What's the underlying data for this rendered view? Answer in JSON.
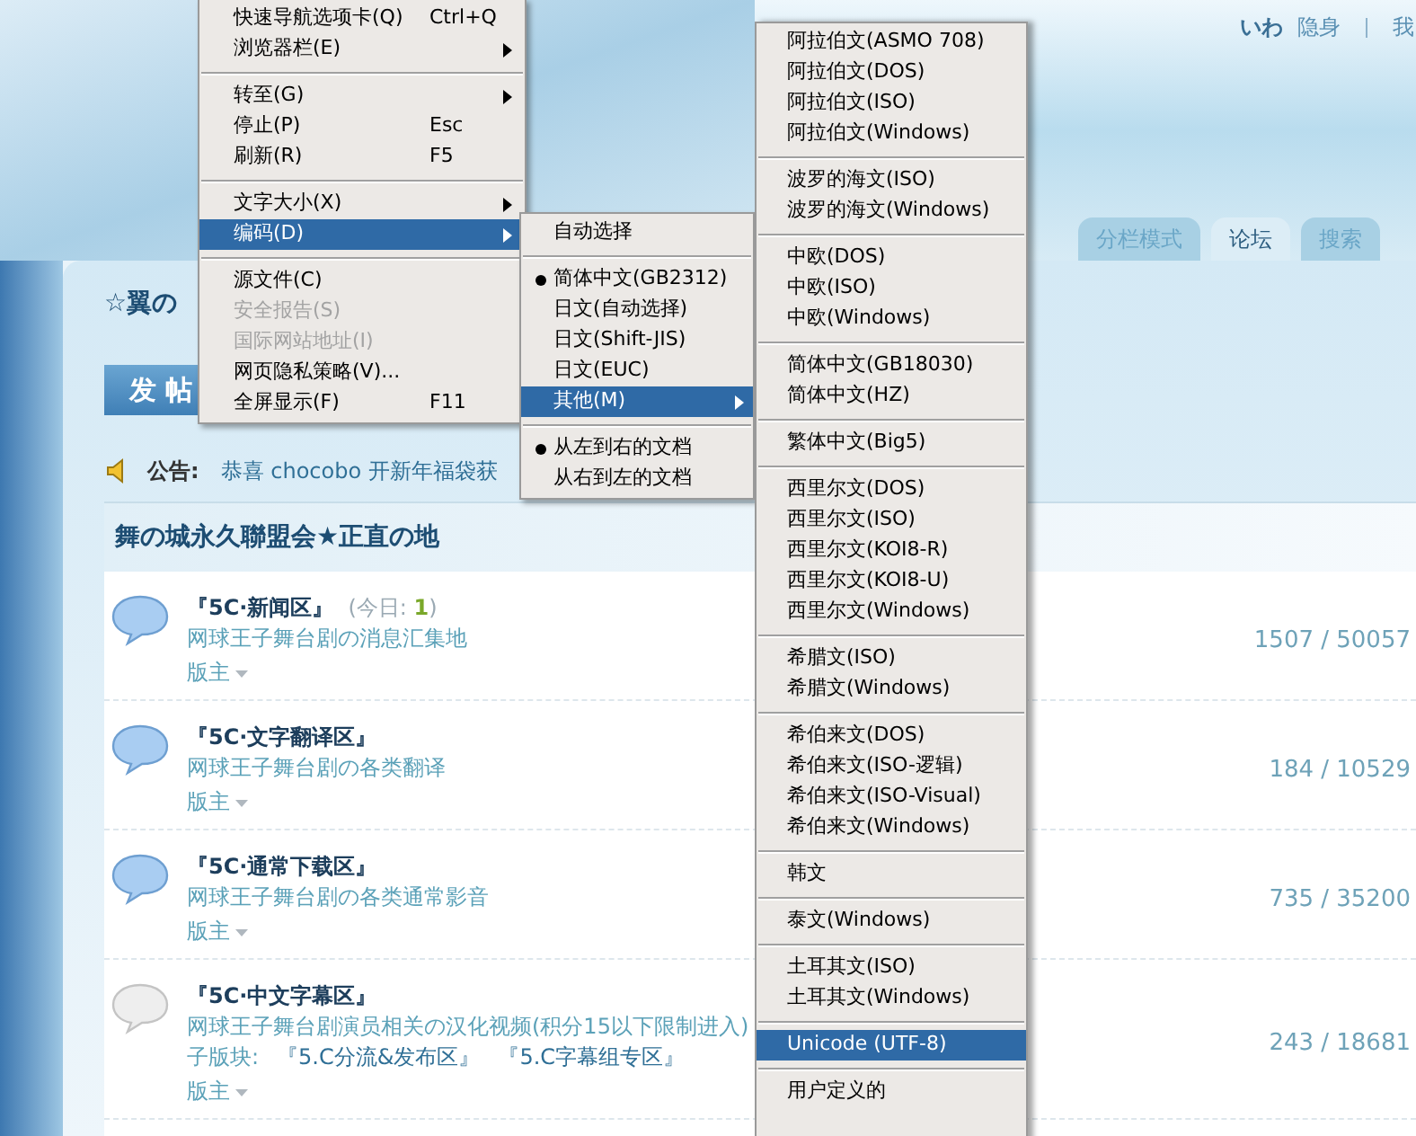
{
  "header": {
    "user": "いわ",
    "links": [
      "隐身",
      "我"
    ],
    "tabs": [
      {
        "label": "分栏模式",
        "selected": false
      },
      {
        "label": "论坛",
        "selected": true
      },
      {
        "label": "搜索",
        "selected": false
      }
    ]
  },
  "section_title": "☆翼の",
  "post_button": "发 帖",
  "notice": {
    "label": "公告:",
    "text": "恭喜 chocobo 开新年福袋获"
  },
  "category": {
    "title": "舞の城永久聯盟会★正直の地",
    "forums": [
      {
        "title": "『5C·新闻区』",
        "today": "(今日: **1**)",
        "description": "网球王子舞台剧の消息汇集地",
        "moderator": "版主",
        "stats": "1507 / 50057",
        "has_new": true
      },
      {
        "title": "『5C·文字翻译区』",
        "description": "网球王子舞台剧の各类翻译",
        "moderator": "版主",
        "stats": "184 / 10529",
        "has_new": true
      },
      {
        "title": "『5C·通常下载区』",
        "description": "网球王子舞台剧の各类通常影音",
        "moderator": "版主",
        "stats": "735 / 35200",
        "has_new": true
      },
      {
        "title": "『5C·中文字幕区』",
        "description": "网球王子舞台剧演员相关の汉化视频(积分15以下限制进入)",
        "subforums_label": "子版块:",
        "subforums": [
          "『5.C分流&发布区』",
          "『5.C字幕组专区』"
        ],
        "moderator": "版主",
        "stats": "243 / 18681",
        "has_new": false
      }
    ]
  },
  "menu": {
    "groups": [
      [
        {
          "label": "快速导航选项卡(Q)",
          "shortcut": "Ctrl+Q",
          "has_submenu": false,
          "disabled": false,
          "selected": false
        },
        {
          "label": "浏览器栏(E)",
          "has_submenu": true,
          "disabled": false,
          "selected": false
        }
      ],
      [
        {
          "label": "转至(G)",
          "has_submenu": true,
          "disabled": false,
          "selected": false
        },
        {
          "label": "停止(P)",
          "shortcut": "Esc",
          "has_submenu": false,
          "disabled": false,
          "selected": false
        },
        {
          "label": "刷新(R)",
          "shortcut": "F5",
          "has_submenu": false,
          "disabled": false,
          "selected": false
        }
      ],
      [
        {
          "label": "文字大小(X)",
          "has_submenu": true,
          "disabled": false,
          "selected": false
        },
        {
          "label": "编码(D)",
          "has_submenu": true,
          "disabled": false,
          "selected": true
        }
      ],
      [
        {
          "label": "源文件(C)",
          "has_submenu": false,
          "disabled": false,
          "selected": false
        },
        {
          "label": "安全报告(S)",
          "has_submenu": false,
          "disabled": true,
          "selected": false
        },
        {
          "label": "国际网站地址(I)",
          "has_submenu": false,
          "disabled": true,
          "selected": false
        },
        {
          "label": "网页隐私策略(V)...",
          "has_submenu": false,
          "disabled": false,
          "selected": false
        },
        {
          "label": "全屏显示(F)",
          "shortcut": "F11",
          "has_submenu": false,
          "disabled": false,
          "selected": false
        }
      ]
    ]
  },
  "encoding_menu": {
    "groups": [
      [
        {
          "label": "自动选择",
          "checked": false,
          "has_submenu": false,
          "selected": false
        }
      ],
      [
        {
          "label": "简体中文(GB2312)",
          "checked": true,
          "has_submenu": false,
          "selected": false
        },
        {
          "label": "日文(自动选择)",
          "checked": false,
          "has_submenu": false,
          "selected": false
        },
        {
          "label": "日文(Shift-JIS)",
          "checked": false,
          "has_submenu": false,
          "selected": false
        },
        {
          "label": "日文(EUC)",
          "checked": false,
          "has_submenu": false,
          "selected": false
        },
        {
          "label": "其他(M)",
          "checked": false,
          "has_submenu": true,
          "selected": true
        }
      ],
      [
        {
          "label": "从左到右的文档",
          "checked": true,
          "has_submenu": false,
          "selected": false
        },
        {
          "label": "从右到左的文档",
          "checked": false,
          "has_submenu": false,
          "selected": false
        }
      ]
    ]
  },
  "other_menu": {
    "groups": [
      [
        {
          "label": "阿拉伯文(ASMO 708)",
          "selected": false
        },
        {
          "label": "阿拉伯文(DOS)",
          "selected": false
        },
        {
          "label": "阿拉伯文(ISO)",
          "selected": false
        },
        {
          "label": "阿拉伯文(Windows)",
          "selected": false
        }
      ],
      [
        {
          "label": "波罗的海文(ISO)",
          "selected": false
        },
        {
          "label": "波罗的海文(Windows)",
          "selected": false
        }
      ],
      [
        {
          "label": "中欧(DOS)",
          "selected": false
        },
        {
          "label": "中欧(ISO)",
          "selected": false
        },
        {
          "label": "中欧(Windows)",
          "selected": false
        }
      ],
      [
        {
          "label": "简体中文(GB18030)",
          "selected": false
        },
        {
          "label": "简体中文(HZ)",
          "selected": false
        }
      ],
      [
        {
          "label": "繁体中文(Big5)",
          "selected": false
        }
      ],
      [
        {
          "label": "西里尔文(DOS)",
          "selected": false
        },
        {
          "label": "西里尔文(ISO)",
          "selected": false
        },
        {
          "label": "西里尔文(KOI8-R)",
          "selected": false
        },
        {
          "label": "西里尔文(KOI8-U)",
          "selected": false
        },
        {
          "label": "西里尔文(Windows)",
          "selected": false
        }
      ],
      [
        {
          "label": "希腊文(ISO)",
          "selected": false
        },
        {
          "label": "希腊文(Windows)",
          "selected": false
        }
      ],
      [
        {
          "label": "希伯来文(DOS)",
          "selected": false
        },
        {
          "label": "希伯来文(ISO-逻辑)",
          "selected": false
        },
        {
          "label": "希伯来文(ISO-Visual)",
          "selected": false
        },
        {
          "label": "希伯来文(Windows)",
          "selected": false
        }
      ],
      [
        {
          "label": "韩文",
          "selected": false
        }
      ],
      [
        {
          "label": "泰文(Windows)",
          "selected": false
        }
      ],
      [
        {
          "label": "土耳其文(ISO)",
          "selected": false
        },
        {
          "label": "土耳其文(Windows)",
          "selected": false
        }
      ],
      [
        {
          "label": "Unicode (UTF-8)",
          "selected": true
        }
      ],
      [
        {
          "label": "用户定义的",
          "selected": false
        }
      ]
    ]
  }
}
